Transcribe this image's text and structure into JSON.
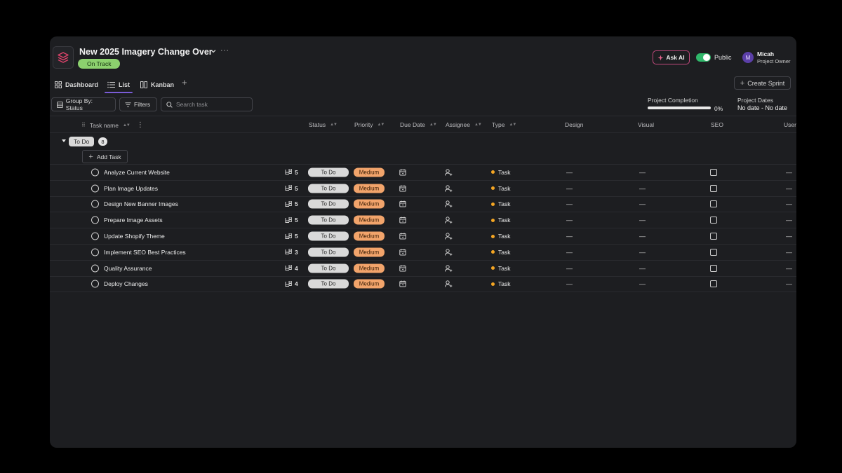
{
  "project": {
    "title": "New 2025 Imagery Change Over",
    "status": "On Track"
  },
  "header": {
    "ask_ai_label": "Ask AI",
    "visibility_label": "Public",
    "user": {
      "initial": "M",
      "name": "Micah",
      "role": "Project Owner"
    }
  },
  "tabs": [
    {
      "label": "Dashboard",
      "icon": "grid-icon"
    },
    {
      "label": "List",
      "icon": "list-icon",
      "active": true
    },
    {
      "label": "Kanban",
      "icon": "kanban-icon"
    }
  ],
  "toolbar": {
    "group_by_label": "Group By: Status",
    "filters_label": "Filters",
    "search_placeholder": "Search task",
    "create_sprint_label": "Create Sprint"
  },
  "summary": {
    "completion_label": "Project Completion",
    "completion_value": "0%",
    "completion_fraction": 0,
    "dates_label": "Project Dates",
    "dates_value": "No date - No date"
  },
  "columns": [
    "Task name",
    "Status",
    "Priority",
    "Due Date",
    "Assignee",
    "Type",
    "Design",
    "Visual",
    "SEO",
    "User"
  ],
  "group": {
    "label": "To Do",
    "count": "8",
    "add_task_label": "Add Task"
  },
  "colors": {
    "accent": "#7a5cd6",
    "on_track": "#8cd16e",
    "priority_medium": "#f2a46b",
    "type_dot": "#f5a623",
    "toggle_on": "#2fb86a"
  },
  "tasks": [
    {
      "name": "Analyze Current Website",
      "subtasks": "5",
      "status": "To Do",
      "priority": "Medium",
      "type": "Task",
      "design": "—",
      "visual": "—",
      "user": "—"
    },
    {
      "name": "Plan Image Updates",
      "subtasks": "5",
      "status": "To Do",
      "priority": "Medium",
      "type": "Task",
      "design": "—",
      "visual": "—",
      "user": "—"
    },
    {
      "name": "Design New Banner Images",
      "subtasks": "5",
      "status": "To Do",
      "priority": "Medium",
      "type": "Task",
      "design": "—",
      "visual": "—",
      "user": "—"
    },
    {
      "name": "Prepare Image Assets",
      "subtasks": "5",
      "status": "To Do",
      "priority": "Medium",
      "type": "Task",
      "design": "—",
      "visual": "—",
      "user": "—"
    },
    {
      "name": "Update Shopify Theme",
      "subtasks": "5",
      "status": "To Do",
      "priority": "Medium",
      "type": "Task",
      "design": "—",
      "visual": "—",
      "user": "—"
    },
    {
      "name": "Implement SEO Best Practices",
      "subtasks": "3",
      "status": "To Do",
      "priority": "Medium",
      "type": "Task",
      "design": "—",
      "visual": "—",
      "user": "—"
    },
    {
      "name": "Quality Assurance",
      "subtasks": "4",
      "status": "To Do",
      "priority": "Medium",
      "type": "Task",
      "design": "—",
      "visual": "—",
      "user": "—"
    },
    {
      "name": "Deploy Changes",
      "subtasks": "4",
      "status": "To Do",
      "priority": "Medium",
      "type": "Task",
      "design": "—",
      "visual": "—",
      "user": "—"
    }
  ]
}
